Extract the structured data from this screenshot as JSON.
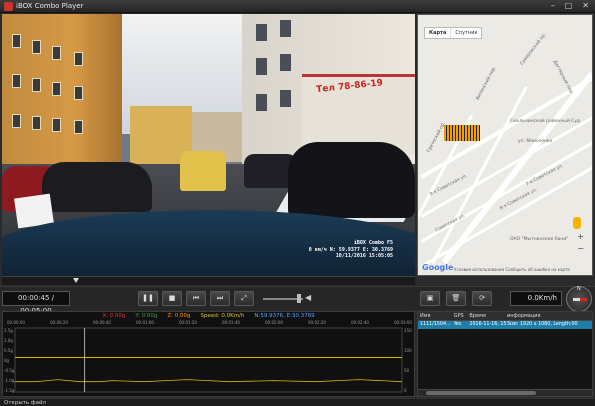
{
  "window": {
    "title": "iBOX Combo Player"
  },
  "video": {
    "osd_line1": "iBOX Combo F5",
    "osd_line2": "0 км/ч  N: 59.9377  E: 30.3769",
    "osd_line3": "10/11/2016  15:05:05",
    "shop_sign": "Тел 78-86-19"
  },
  "map": {
    "tab_map": "Карта",
    "tab_satellite": "Спутник",
    "labels": [
      "Суворовский пр.",
      "Смольнинский районный Суд",
      "ул. Моисеенко",
      "7-я Советская ул.",
      "8-я Советская ул.",
      "9-я Советская ул.",
      "Дегтярный пер.",
      "Советская ул.",
      "ОАО \"Мытнинские бани\"",
      "Греческий пр.",
      "Виленский пер."
    ],
    "footer": "Условия использования   Сообщить об ошибке на карте",
    "logo": "Google"
  },
  "controls": {
    "time": "00:00:45 / 00:05:00",
    "speed": "0.0Km/h",
    "buttons": {
      "pause": "❚❚",
      "stop": "■",
      "prev": "⏮",
      "next": "⏭",
      "fullscreen": "⤢",
      "capture": "▣",
      "delete": "🗑",
      "refresh": "⟳"
    },
    "volume_level": 0.85,
    "compass_label": "N"
  },
  "graph": {
    "legend": {
      "x": "X: 0.00g",
      "y": "Y: 0.00g",
      "z": "Z: 0.00g",
      "speed": "Speed: 0.0Km/h",
      "coords": "N:59.9376, E:30.3769"
    },
    "colors": {
      "x": "#e53935",
      "y": "#43a047",
      "z": "#ff9800",
      "speed": "#e0c020",
      "coords": "#4aa8ff",
      "line": "#d9b800"
    },
    "ticks": [
      "00:00:00",
      "00:00:20",
      "00:00:40",
      "00:01:00",
      "00:01:20",
      "00:01:40",
      "00:02:00",
      "00:02:20",
      "00:02:40",
      "00:03:00"
    ],
    "y_left": [
      "1.5g",
      "1.0g",
      "0.5g",
      "0g",
      "-0.5g",
      "-1.0g",
      "-1.5g"
    ],
    "y_right": [
      "150",
      "100",
      "50",
      "0"
    ],
    "cursor_position": 0.18
  },
  "chart_data": {
    "type": "line",
    "x": [
      0,
      10,
      20,
      30,
      40,
      45,
      60,
      80,
      100,
      120,
      140,
      160,
      180
    ],
    "series": [
      {
        "name": "Z",
        "values": [
          -1.0,
          -1.0,
          -0.9,
          -1.0,
          -1.0,
          -0.95,
          -1.0,
          -0.9,
          -1.0,
          -0.95,
          -1.0,
          -0.9,
          -1.0
        ]
      },
      {
        "name": "Speed",
        "values": [
          0,
          0,
          0,
          0,
          0,
          0,
          0,
          0,
          0,
          0,
          0,
          0,
          0
        ]
      }
    ],
    "ylim": [
      -1.5,
      1.5
    ]
  },
  "info_table": {
    "headers": [
      "Имя",
      "GPS",
      "Время",
      "информация"
    ],
    "rows": [
      [
        "1111/1504...",
        "Yes",
        "2016-11-16, 15:5",
        "Size: 1920 x 1080, Length:00"
      ]
    ]
  },
  "status": {
    "text": "Открыть файл"
  }
}
